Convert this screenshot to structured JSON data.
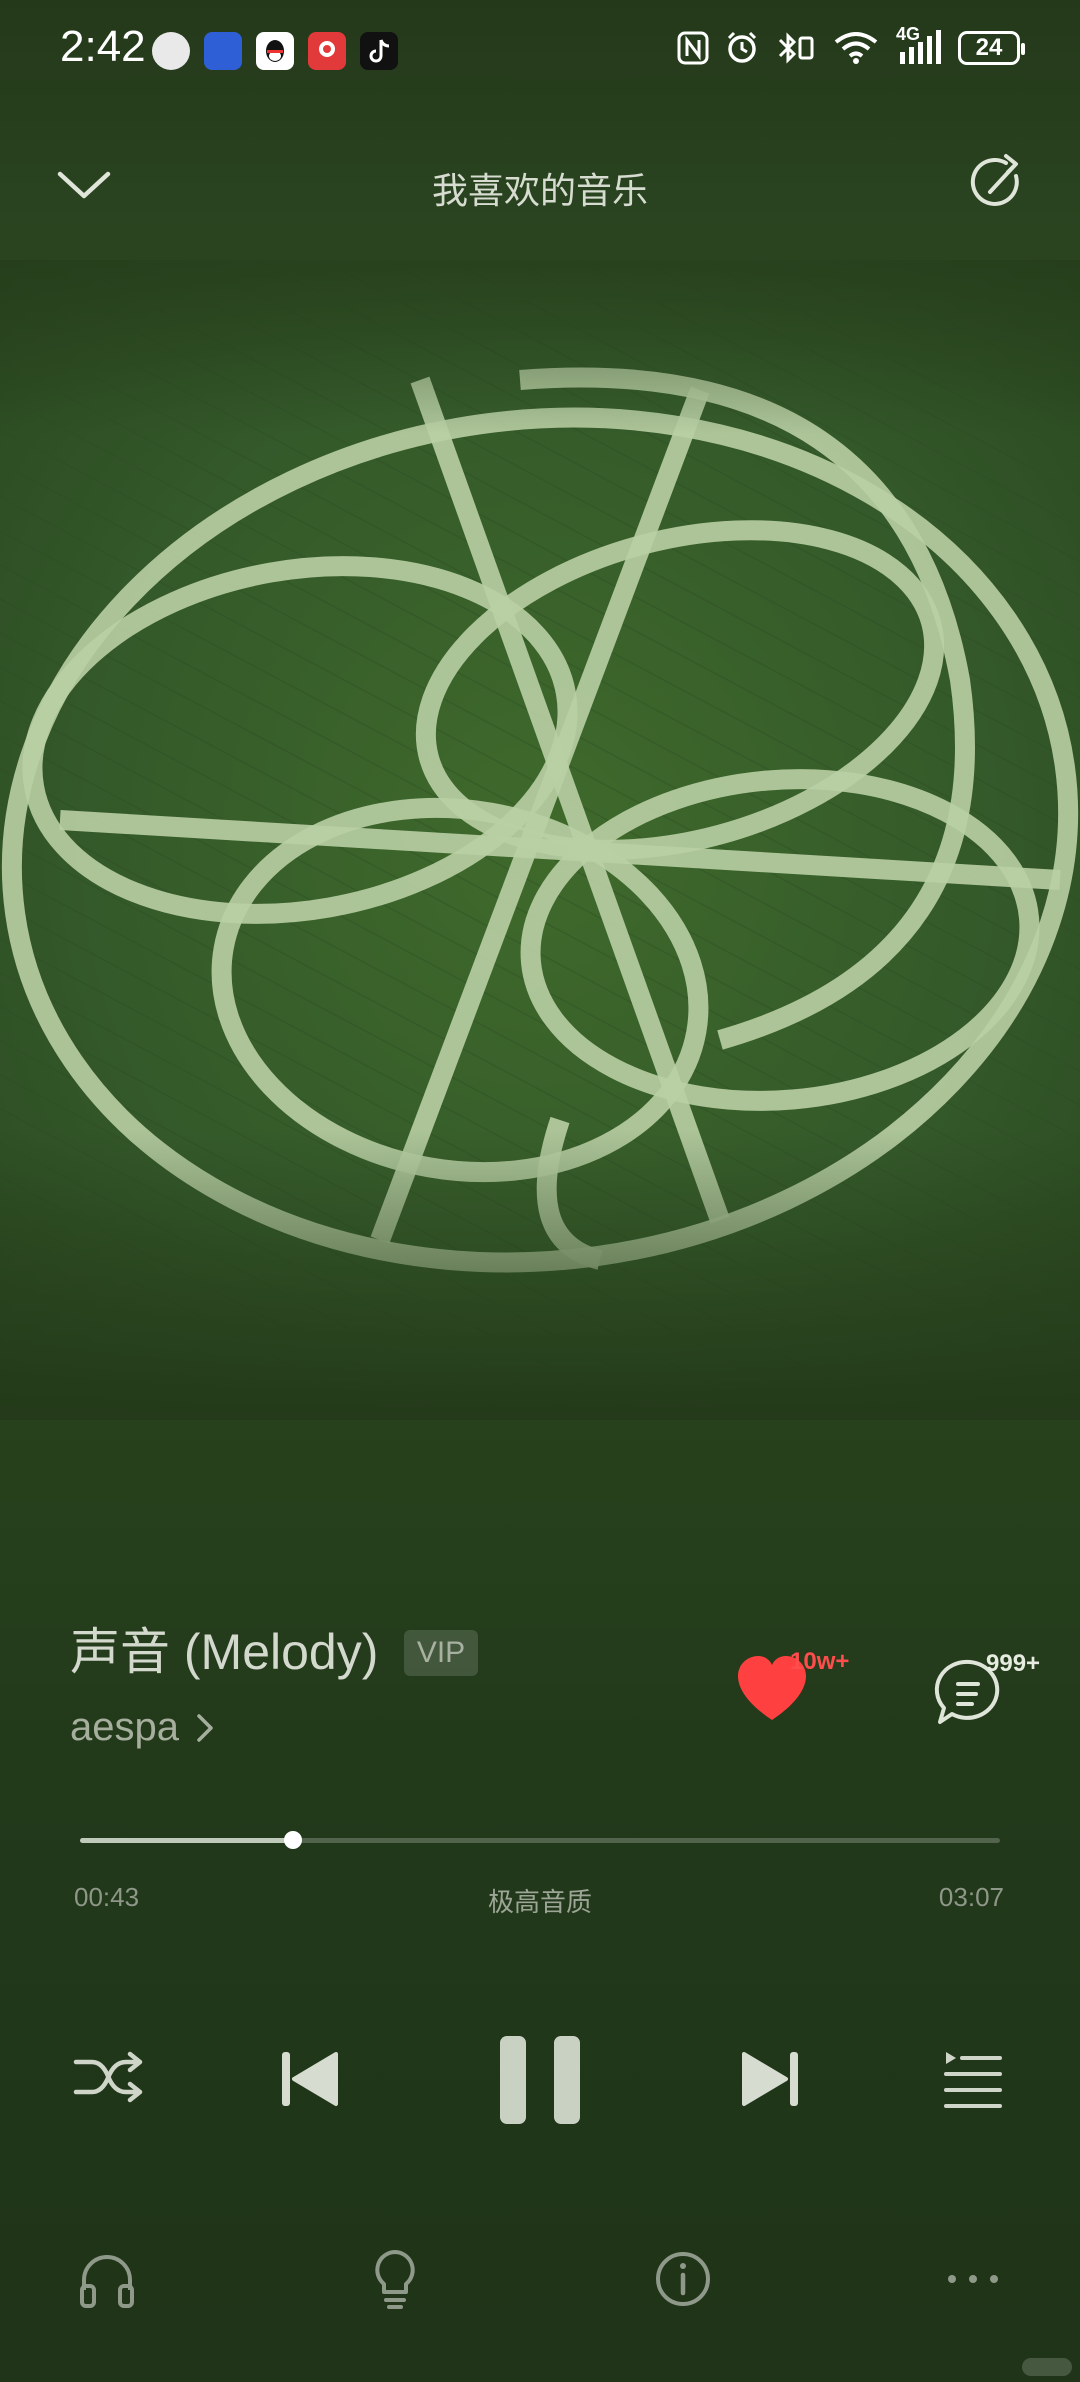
{
  "status_bar": {
    "time": "2:42",
    "battery": "24",
    "notification_icons": [
      {
        "name": "avatar-app-icon",
        "color": "#e8e8e8"
      },
      {
        "name": "news-app-icon",
        "color": "#2f5fd6"
      },
      {
        "name": "qq-icon",
        "color": "#ffffff"
      },
      {
        "name": "red-app-icon",
        "color": "#e23a3a"
      },
      {
        "name": "tiktok-icon",
        "color": "#111111"
      }
    ],
    "system_icons": [
      "nfc-icon",
      "alarm-icon",
      "bluetooth-vibrate-icon",
      "wifi-icon",
      "signal-icon",
      "battery-icon"
    ],
    "network_label": "4G"
  },
  "header": {
    "title": "我喜欢的音乐",
    "back_icon": "chevron-down-icon",
    "share_icon": "share-icon"
  },
  "song": {
    "title": "声音 (Melody)",
    "badge": "VIP",
    "artist": "aespa"
  },
  "actions": {
    "like_count": "10w+",
    "comment_count": "999+",
    "like_color": "#ff4040"
  },
  "player": {
    "current_time": "00:43",
    "total_time": "03:07",
    "quality": "极高音质",
    "progress_fraction": 0.232
  },
  "controls": [
    "shuffle-icon",
    "previous-icon",
    "pause-icon",
    "next-icon",
    "playlist-icon"
  ],
  "bottom_bar": [
    "headphones-icon",
    "lightbulb-icon",
    "info-icon",
    "more-icon"
  ]
}
